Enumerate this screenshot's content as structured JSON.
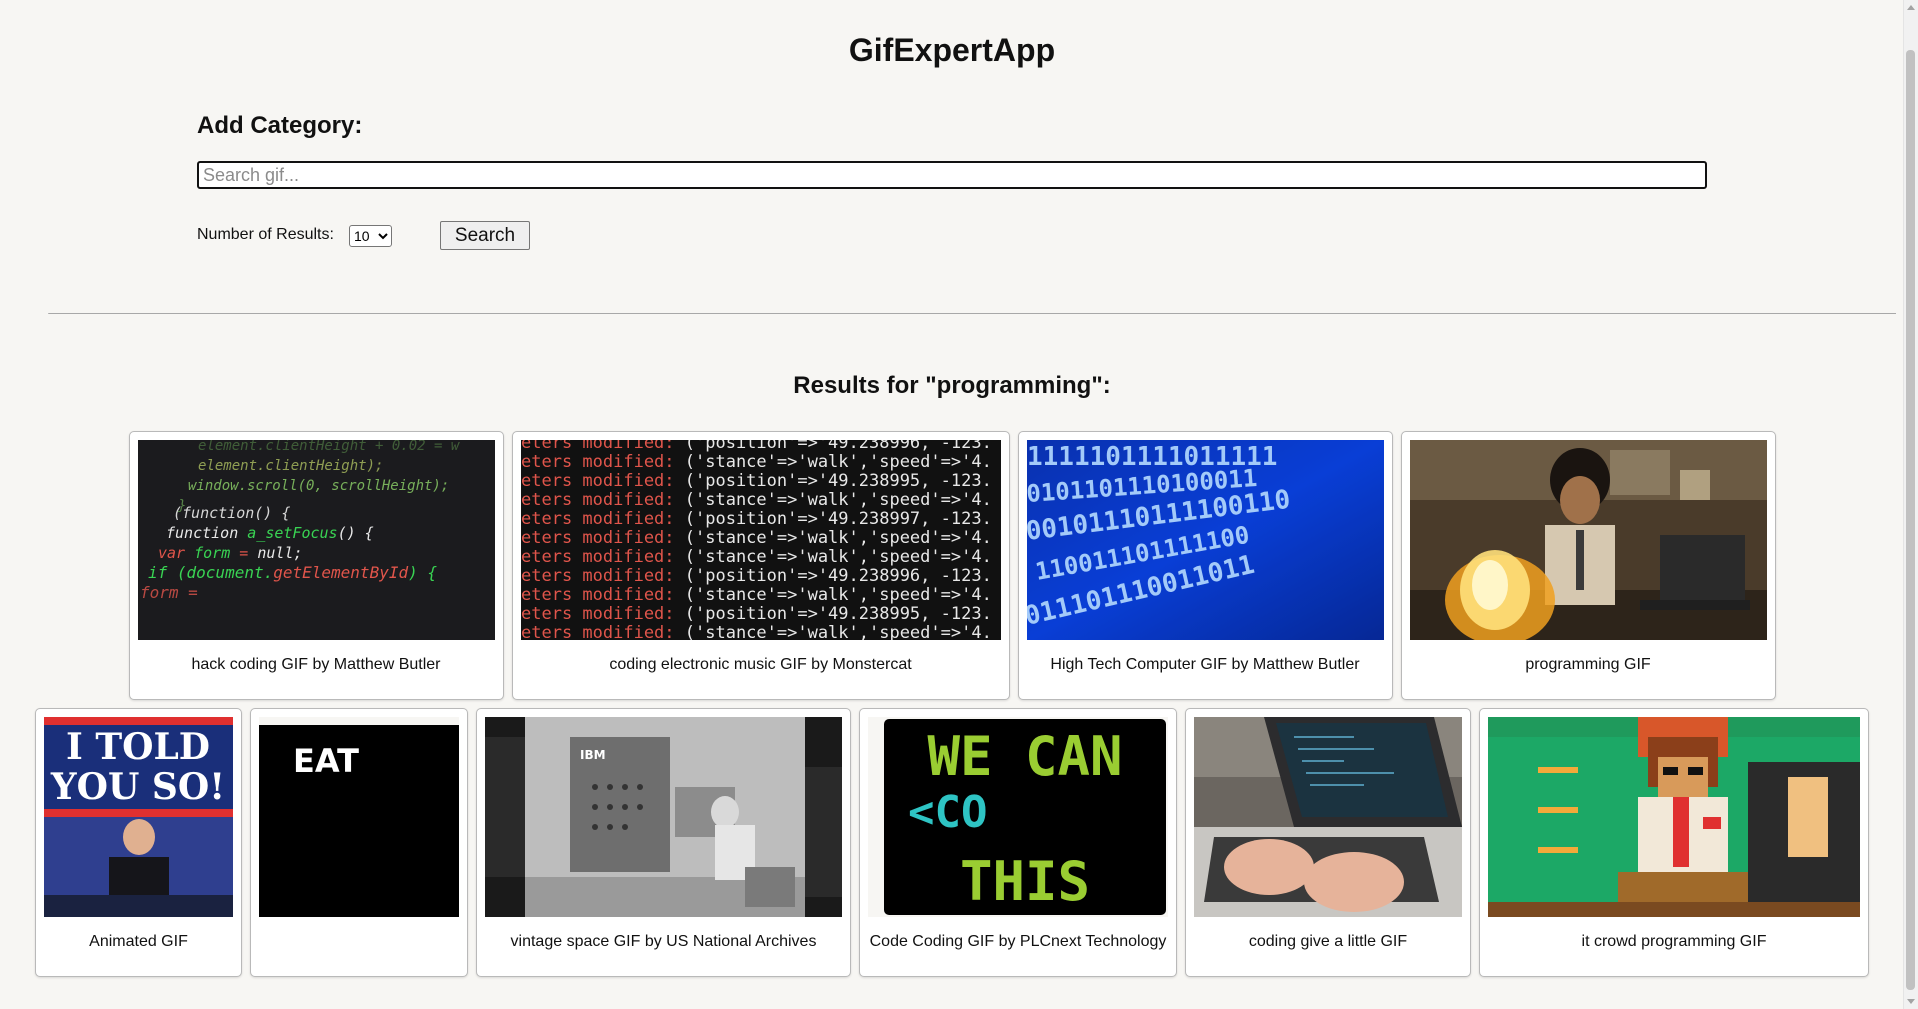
{
  "app": {
    "title": "GifExpertApp"
  },
  "form": {
    "add_category_label": "Add Category:",
    "search_placeholder": "Search gif...",
    "search_value": "",
    "results_label": "Number of Results:",
    "results_selected": "10",
    "search_button": "Search"
  },
  "results": {
    "heading": "Results for \"programming\":",
    "row1": [
      {
        "title": "hack coding GIF by Matthew Butler",
        "icon": "code-screen-image"
      },
      {
        "title": "coding electronic music GIF by Monstercat",
        "icon": "terminal-log-image"
      },
      {
        "title": "High Tech Computer GIF by Matthew Butler",
        "icon": "binary-code-image"
      },
      {
        "title": "programming GIF",
        "icon": "it-crowd-fire-image"
      }
    ],
    "row2": [
      {
        "title": "Animated GIF",
        "icon": "i-told-you-so-image",
        "overlay": [
          "I TOLD",
          "YOU SO!"
        ]
      },
      {
        "title": "",
        "icon": "eat-text-image",
        "overlay": [
          "EAT"
        ]
      },
      {
        "title": "vintage space GIF by US National Archives",
        "icon": "ibm-computer-image",
        "overlay": [
          "IBM"
        ]
      },
      {
        "title": "Code Coding GIF by PLCnext Technology",
        "icon": "we-can-code-image",
        "overlay": [
          "WE CAN",
          "<CO",
          "THIS"
        ]
      },
      {
        "title": "coding give a little GIF",
        "icon": "laptop-typing-image"
      },
      {
        "title": "it crowd programming GIF",
        "icon": "pixel-art-image"
      }
    ]
  },
  "colors": {
    "background": "#f7f6f3",
    "card_border": "#b9b9b9",
    "code_green": "#39d353",
    "code_red": "#e0554b",
    "binary_blue": "#0a3fd6",
    "we_can_green": "#9acd32",
    "we_can_cyan": "#2ec4c4"
  }
}
